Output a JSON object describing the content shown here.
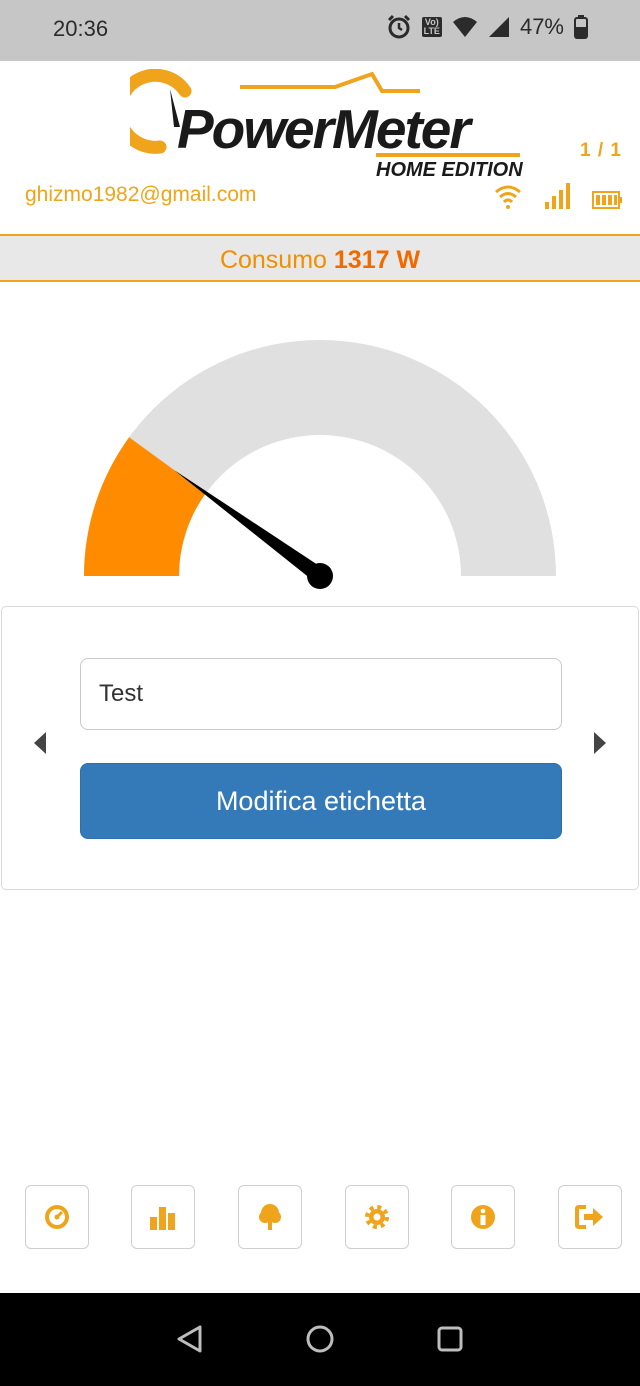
{
  "status_bar": {
    "time": "20:36",
    "battery": "47%",
    "network": "LTE"
  },
  "header": {
    "logo_word": "PowerMeter",
    "logo_edition": "HOME EDITION",
    "page_indicator": "1 / 1",
    "email": "ghizmo1982@gmail.com",
    "icons": [
      "wifi-icon",
      "signal-icon",
      "battery-icon"
    ]
  },
  "consumption": {
    "label": "Consumo",
    "value": "1317 W"
  },
  "gauge": {
    "fraction": 0.2
  },
  "label_card": {
    "input_value": "Test",
    "button_label": "Modifica etichetta"
  },
  "bottom_nav": [
    "gauge-icon",
    "bar-chart-icon",
    "tree-icon",
    "gear-icon",
    "info-icon",
    "logout-icon"
  ],
  "colors": {
    "accent": "#f0a41c",
    "gauge_fill": "#ff8c00",
    "button": "#357ab8"
  }
}
